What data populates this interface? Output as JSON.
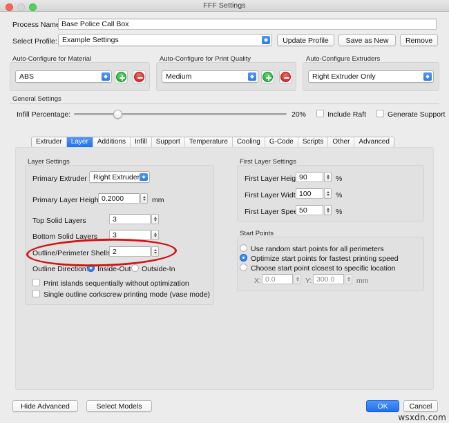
{
  "window": {
    "title": "FFF Settings",
    "traffic": {
      "close": "close-button",
      "minimize": "minimize-button",
      "maximize": "maximize-button"
    }
  },
  "header": {
    "process_name_label": "Process Name:",
    "process_name_value": "Base Police Call Box",
    "select_profile_label": "Select Profile:",
    "select_profile_value": "Example Settings",
    "update_profile": "Update Profile",
    "save_as_new": "Save as New",
    "remove": "Remove"
  },
  "autoconfigure": {
    "material": {
      "title": "Auto-Configure for Material",
      "value": "ABS",
      "add": "+",
      "remove": "−"
    },
    "quality": {
      "title": "Auto-Configure for Print Quality",
      "value": "Medium",
      "add": "+",
      "remove": "−"
    },
    "extruders": {
      "title": "Auto-Configure Extruders",
      "value": "Right Extruder Only"
    }
  },
  "general": {
    "title": "General Settings",
    "infill_label": "Infill Percentage:",
    "infill_value": "20%",
    "infill_percent": 20,
    "include_raft_label": "Include Raft",
    "include_raft_checked": false,
    "generate_support_label": "Generate Support",
    "generate_support_checked": false
  },
  "tabs": [
    {
      "label": "Extruder",
      "active": false
    },
    {
      "label": "Layer",
      "active": true
    },
    {
      "label": "Additions",
      "active": false
    },
    {
      "label": "Infill",
      "active": false
    },
    {
      "label": "Support",
      "active": false
    },
    {
      "label": "Temperature",
      "active": false
    },
    {
      "label": "Cooling",
      "active": false
    },
    {
      "label": "G-Code",
      "active": false
    },
    {
      "label": "Scripts",
      "active": false
    },
    {
      "label": "Other",
      "active": false
    },
    {
      "label": "Advanced",
      "active": false
    }
  ],
  "layer_settings": {
    "title": "Layer Settings",
    "primary_extruder_label": "Primary Extruder",
    "primary_extruder_value": "Right Extruder",
    "primary_layer_height_label": "Primary Layer Height",
    "primary_layer_height_value": "0.2000",
    "primary_layer_height_unit": "mm",
    "top_solid_layers_label": "Top Solid Layers",
    "top_solid_layers_value": "3",
    "bottom_solid_layers_label": "Bottom Solid Layers",
    "bottom_solid_layers_value": "3",
    "outline_shells_label": "Outline/Perimeter Shells",
    "outline_shells_value": "2",
    "outline_direction_label": "Outline Direction:",
    "outline_direction_inside_out": "Inside-Out",
    "outline_direction_outside_in": "Outside-In",
    "outline_direction_selected": "Inside-Out",
    "print_islands_label": "Print islands sequentially without optimization",
    "print_islands_checked": false,
    "vase_mode_label": "Single outline corkscrew printing mode (vase mode)",
    "vase_mode_checked": false
  },
  "first_layer_settings": {
    "title": "First Layer Settings",
    "height_label": "First Layer Height",
    "height_value": "90",
    "height_unit": "%",
    "width_label": "First Layer Width",
    "width_value": "100",
    "width_unit": "%",
    "speed_label": "First Layer Speed",
    "speed_value": "50",
    "speed_unit": "%"
  },
  "start_points": {
    "title": "Start Points",
    "random_label": "Use random start points for all perimeters",
    "optimize_label": "Optimize start points for fastest printing speed",
    "closest_label": "Choose start point closest to specific location",
    "selected": "Optimize start points for fastest printing speed",
    "x_label": "X:",
    "x_value": "0.0",
    "y_label": "Y:",
    "y_value": "300.0",
    "unit": "mm"
  },
  "footer": {
    "hide_advanced": "Hide Advanced",
    "select_models": "Select Models",
    "ok": "OK",
    "cancel": "Cancel"
  },
  "watermark": "wsxdn.com",
  "colors": {
    "accent_blue": "#1f73ee",
    "annotation_red": "#d11414",
    "add_green": "#1da832",
    "remove_red": "#c71f1d",
    "window_bg": "#ececec"
  }
}
